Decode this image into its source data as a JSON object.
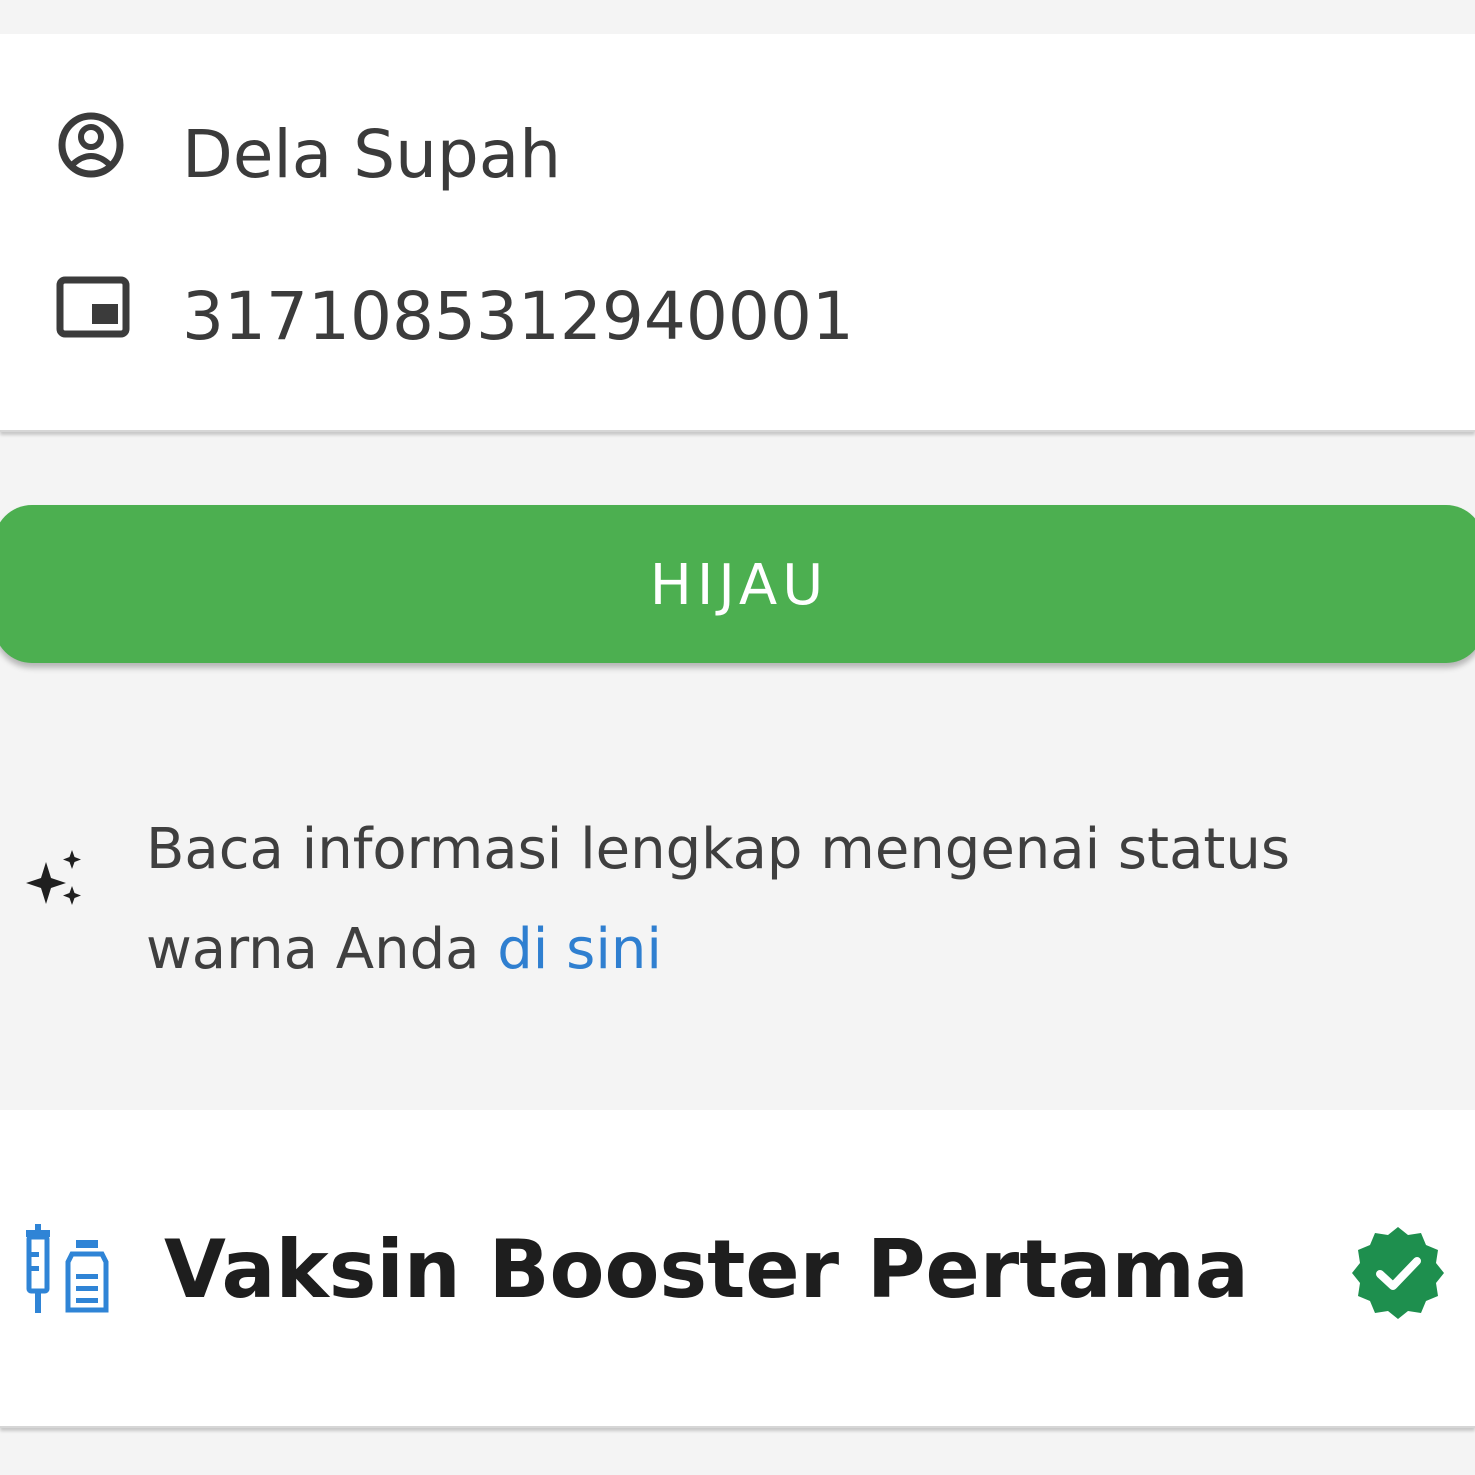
{
  "identity": {
    "name": "Dela Supah",
    "nik": "3171085312940001",
    "name_icon": "user-circle-icon",
    "nik_icon": "id-card-icon"
  },
  "status": {
    "label": "HIJAU",
    "color": "#4caf50"
  },
  "info": {
    "icon": "sparkle-icon",
    "text": "Baca informasi lengkap mengenai status warna Anda ",
    "link_text": "di sini",
    "link_color": "#2f7fd0"
  },
  "vaccine": {
    "icon": "syringe-vial-icon",
    "title": "Vaksin Booster Pertama",
    "status_icon": "verified-check-icon",
    "status_color": "#1e8f4e"
  }
}
